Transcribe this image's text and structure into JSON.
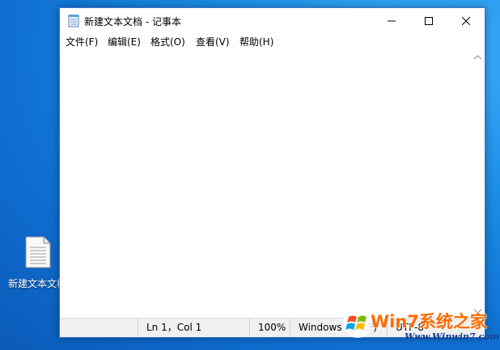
{
  "desktop": {
    "icon_label": "新建文本文档"
  },
  "window": {
    "title": "新建文本文档 - 记事本",
    "controls": [
      "minimize",
      "maximize",
      "close"
    ]
  },
  "menu": {
    "items": [
      {
        "label": "文件(F)"
      },
      {
        "label": "编辑(E)"
      },
      {
        "label": "格式(O)"
      },
      {
        "label": "查看(V)"
      },
      {
        "label": "帮助(H)"
      }
    ]
  },
  "editor": {
    "content": ""
  },
  "status": {
    "position": "Ln 1，Col 1",
    "zoom": "100%",
    "line_ending": "Windows (CRLF)",
    "encoding": "UTF-8"
  },
  "watermark": {
    "brand": "Win7系统之家",
    "url": "Www.Winwin7.com"
  }
}
